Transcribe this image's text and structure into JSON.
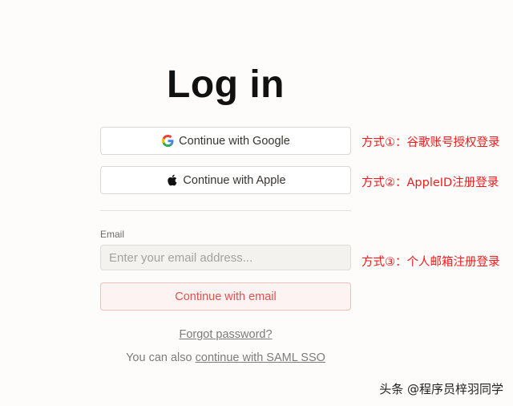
{
  "page": {
    "title": "Log in"
  },
  "buttons": {
    "google": {
      "label": "Continue with Google",
      "icon": "google-icon"
    },
    "apple": {
      "label": "Continue with Apple",
      "icon": "apple-icon"
    },
    "email": {
      "label": "Continue with email"
    }
  },
  "email": {
    "label": "Email",
    "placeholder": "Enter your email address...",
    "value": ""
  },
  "links": {
    "forgot_password": "Forgot password?",
    "saml_prefix": "You can also ",
    "saml_link": "continue with SAML SSO"
  },
  "annotations": [
    "方式①：谷歌账号授权登录",
    "方式②：AppleID注册登录",
    "方式③：个人邮箱注册登录"
  ],
  "watermark": "头条 @程序员梓羽同学",
  "colors": {
    "background": "#fdfcfb",
    "annotation": "#ee1c1c",
    "email_button_text": "#e0534c",
    "email_button_bg": "#fdf3f2"
  }
}
